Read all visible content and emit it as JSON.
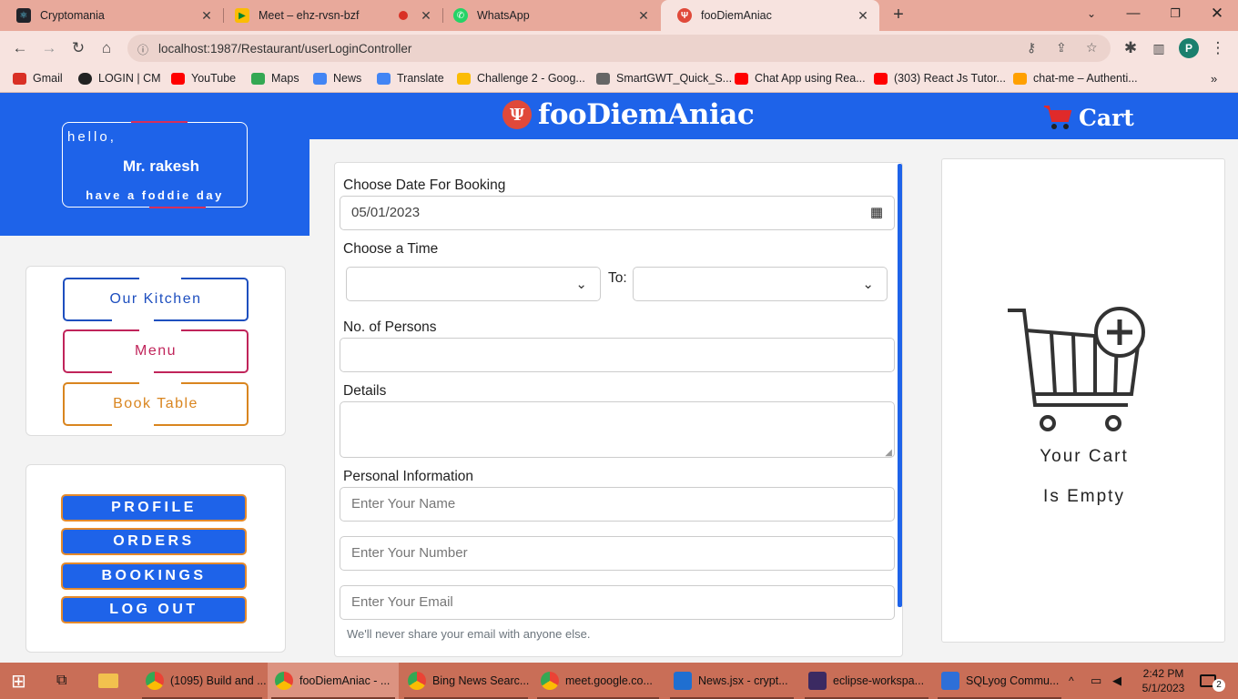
{
  "browser": {
    "tabs": [
      {
        "label": "Cryptomania",
        "icon": "react-icon"
      },
      {
        "label": "Meet – ehz-rvsn-bzf",
        "icon": "meet-icon",
        "recording": true
      },
      {
        "label": "WhatsApp",
        "icon": "whatsapp-icon"
      },
      {
        "label": "fooDiemAniac",
        "icon": "fork-icon",
        "active": true
      }
    ],
    "url": "localhost:1987/Restaurant/userLoginController",
    "bookmarks": [
      {
        "label": "Gmail",
        "color": "#d93025"
      },
      {
        "label": "LOGIN | CM",
        "color": "#222222"
      },
      {
        "label": "YouTube",
        "color": "#ff0000"
      },
      {
        "label": "Maps",
        "color": "#34a853"
      },
      {
        "label": "News",
        "color": "#4285f4"
      },
      {
        "label": "Translate",
        "color": "#4285f4"
      },
      {
        "label": "Challenge 2 - Goog...",
        "color": "#fbbc04"
      },
      {
        "label": "SmartGWT_Quick_S...",
        "color": "#666666"
      },
      {
        "label": "Chat App using Rea...",
        "color": "#ff0000"
      },
      {
        "label": "(303) React Js Tutor...",
        "color": "#ff0000"
      },
      {
        "label": "chat-me – Authenti...",
        "color": "#ffa000"
      }
    ]
  },
  "header": {
    "brand": "fooDiemAniac",
    "cart_label": "Cart"
  },
  "greeting": {
    "hello": "hello,",
    "name": "Mr. rakesh",
    "tagline": "have a foddie day"
  },
  "nav": {
    "kitchen": "Our Kitchen",
    "menu": "Menu",
    "book": "Book Table"
  },
  "account": {
    "profile": "PROFILE",
    "orders": "ORDERS",
    "bookings": "BOOKINGS",
    "logout": "LOG OUT"
  },
  "form": {
    "date_label": "Choose Date For Booking",
    "date_value": "05/01/2023",
    "time_label": "Choose a Time",
    "to_label": "To:",
    "persons_label": "No. of Persons",
    "details_label": "Details",
    "personal_label": "Personal Information",
    "name_placeholder": "Enter Your Name",
    "number_placeholder": "Enter Your Number",
    "email_placeholder": "Enter Your Email",
    "email_help": "We'll never share your email with anyone else."
  },
  "cart": {
    "line1": "Your Cart",
    "line2": "Is Empty"
  },
  "taskbar": {
    "items": [
      {
        "label": "(1095) Build and ...",
        "color": "#34a853"
      },
      {
        "label": "fooDiemAniac - ...",
        "color": "#34a853",
        "active": true
      },
      {
        "label": "Bing News Searc...",
        "color": "#34a853"
      },
      {
        "label": "meet.google.co...",
        "color": "#34a853"
      },
      {
        "label": "News.jsx - crypt...",
        "color": "#1f6fd1"
      },
      {
        "label": "eclipse-workspa...",
        "color": "#3b2a62"
      },
      {
        "label": "SQLyog Commu...",
        "color": "#2e6fd8"
      }
    ],
    "time": "2:42 PM",
    "date": "5/1/2023",
    "notifications": "2"
  }
}
